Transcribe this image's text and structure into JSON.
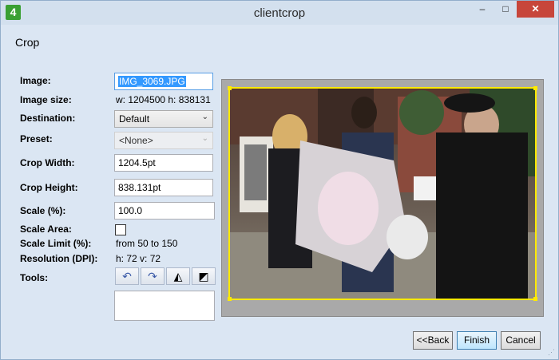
{
  "window": {
    "title": "clientcrop",
    "icon_label": "4"
  },
  "titlebar_buttons": {
    "minimize": "–",
    "maximize": "□",
    "close": "✕"
  },
  "section_title": "Crop",
  "labels": {
    "image": "Image:",
    "image_size": "Image size:",
    "destination": "Destination:",
    "preset": "Preset:",
    "crop_width": "Crop Width:",
    "crop_height": "Crop Height:",
    "scale": "Scale (%):",
    "scale_area": "Scale Area:",
    "scale_limit": "Scale Limit (%):",
    "resolution": "Resolution (DPI):",
    "tools": "Tools:"
  },
  "values": {
    "image": "IMG_3069.JPG",
    "image_size": "w: 1204500 h: 838131",
    "destination": "Default",
    "preset": "<None>",
    "crop_width": "1204.5pt",
    "crop_height": "838.131pt",
    "scale": "100.0",
    "scale_area_checked": false,
    "scale_limit": "from 50 to 150",
    "resolution": "h: 72 v: 72"
  },
  "tools": {
    "rotate_left": "↶",
    "rotate_right": "↷",
    "flip_horizontal": "◭",
    "flip_vertical": "◩"
  },
  "buttons": {
    "back": "<<Back",
    "finish": "Finish",
    "cancel": "Cancel"
  },
  "colors": {
    "crop_frame": "#ffea00",
    "close_button": "#c7463b",
    "default_button": "#bee6fd"
  }
}
